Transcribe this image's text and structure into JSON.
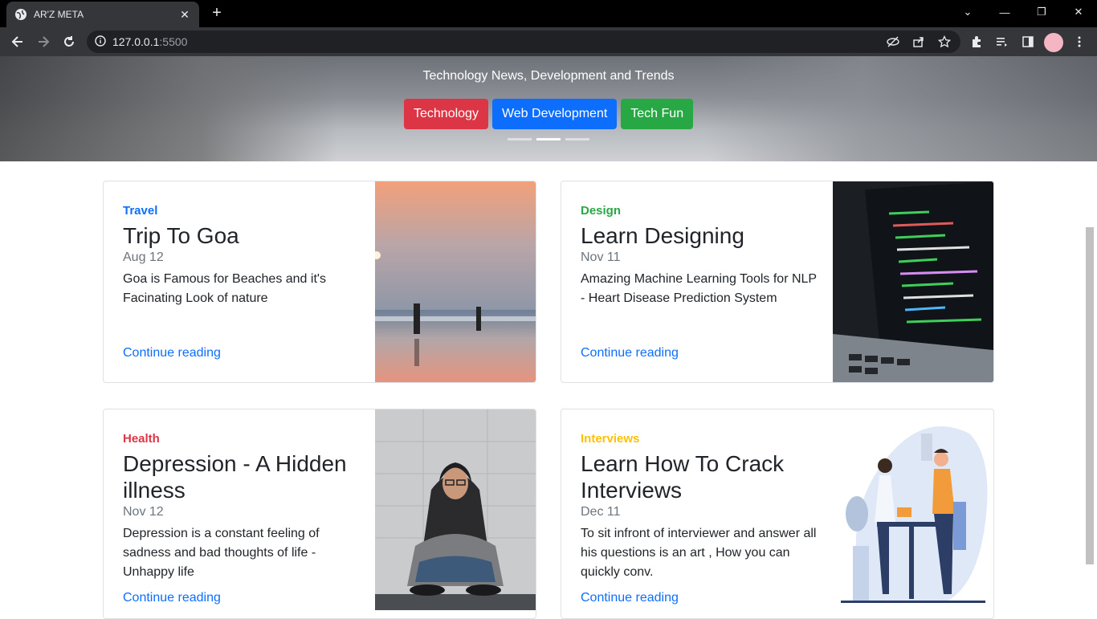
{
  "browser": {
    "tab_title": "AR'Z META",
    "url_host": "127.0.0.1",
    "url_port": ":5500"
  },
  "hero": {
    "subtitle": "Technology News, Development and Trends",
    "buttons": [
      {
        "label": "Technology",
        "color": "#dc3545"
      },
      {
        "label": "Web Development",
        "color": "#0d6efd"
      },
      {
        "label": "Tech Fun",
        "color": "#28a745"
      }
    ]
  },
  "cards": [
    {
      "category": "Travel",
      "category_color": "#0d6efd",
      "title": "Trip To Goa",
      "date": "Aug 12",
      "desc": "Goa is Famous for Beaches and it's Facinating Look of nature",
      "link": "Continue reading"
    },
    {
      "category": "Design",
      "category_color": "#28a745",
      "title": "Learn Designing",
      "date": "Nov 11",
      "desc": "Amazing Machine Learning Tools for NLP - Heart Disease Prediction System",
      "link": "Continue reading"
    },
    {
      "category": "Health",
      "category_color": "#dc3545",
      "title": "Depression - A Hidden illness",
      "date": "Nov 12",
      "desc": "Depression is a constant feeling of sadness and bad thoughts of life - Unhappy life",
      "link": "Continue reading"
    },
    {
      "category": "Interviews",
      "category_color": "#ffc107",
      "title": "Learn How To Crack Interviews",
      "date": "Dec 11",
      "desc": "To sit infront of interviewer and answer all his questions is an art , How you can quickly conv.",
      "link": "Continue reading"
    }
  ]
}
